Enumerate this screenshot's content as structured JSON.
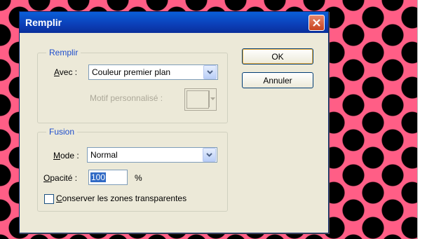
{
  "dialog": {
    "title": "Remplir",
    "ok_label": "OK",
    "cancel_label": "Annuler",
    "fill_group": {
      "legend": "Remplir",
      "use_label_prefix": "A",
      "use_label_rest": "vec :",
      "use_value": "Couleur premier plan",
      "pattern_label": "Motif personnalisé :"
    },
    "blend_group": {
      "legend": "Fusion",
      "mode_label_prefix": "M",
      "mode_label_rest": "ode :",
      "mode_value": "Normal",
      "opacity_label_prefix": "O",
      "opacity_label_rest": "pacité :",
      "opacity_value": "100",
      "opacity_unit": "%",
      "preserve_prefix": "C",
      "preserve_rest": "onserver les zones transparentes",
      "preserve_checked": false
    }
  },
  "icons": {
    "close": "close-icon",
    "dropdown": "chevron-down-icon"
  },
  "colors": {
    "canvas_pink": "#ff5e86",
    "title_blue": "#0b3fb8",
    "legend_blue": "#1f4ecc",
    "selection_blue": "#316ac5"
  }
}
